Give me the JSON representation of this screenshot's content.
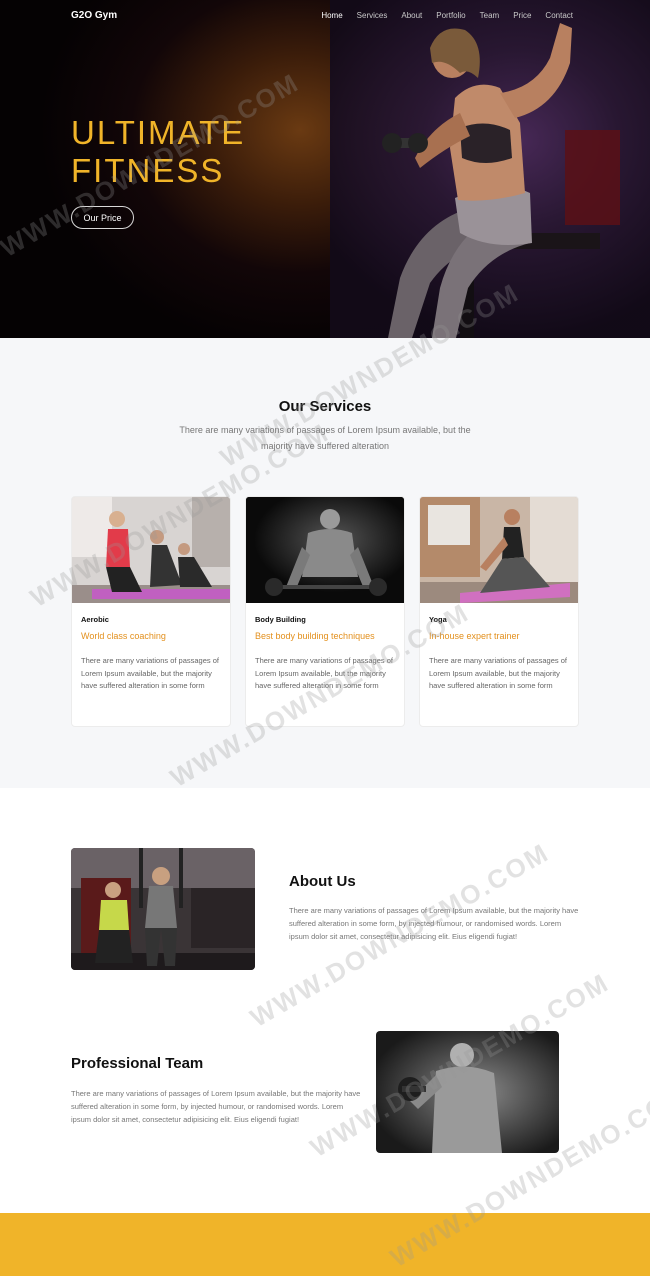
{
  "nav": {
    "brand": "G2O Gym",
    "items": [
      {
        "label": "Home"
      },
      {
        "label": "Services"
      },
      {
        "label": "About"
      },
      {
        "label": "Portfolio"
      },
      {
        "label": "Team"
      },
      {
        "label": "Price"
      },
      {
        "label": "Contact"
      }
    ]
  },
  "hero": {
    "title_line1": "ULTIMATE",
    "title_line2": "FITNESS",
    "button": "Our Price"
  },
  "services": {
    "title": "Our Services",
    "subtitle": "There are many variations of passages of Lorem Ipsum available, but the majority have suffered alteration",
    "cards": [
      {
        "category": "Aerobic",
        "heading": "World class coaching",
        "text": "There are many variations of passages of Lorem Ipsum available, but the majority have suffered alteration in some form"
      },
      {
        "category": "Body Building",
        "heading": "Best body building techniques",
        "text": "There are many variations of passages of Lorem Ipsum available, but the majority have suffered alteration in some form"
      },
      {
        "category": "Yoga",
        "heading": "In-house expert trainer",
        "text": "There are many variations of passages of Lorem Ipsum available, but the majority have suffered alteration in some form"
      }
    ]
  },
  "about": {
    "title": "About Us",
    "text": "There are many variations of passages of Lorem Ipsum available, but the majority have suffered alteration in some form, by injected humour, or randomised words. Lorem ipsum dolor sit amet, consectetur adipisicing elit. Eius eligendi fugiat!"
  },
  "team": {
    "title": "Professional Team",
    "text": "There are many variations of passages of Lorem Ipsum available, but the majority have suffered alteration in some form, by injected humour, or randomised words. Lorem ipsum dolor sit amet, consectetur adipisicing elit. Eius eligendi fugiat!"
  },
  "watermark": "WWW.DOWNDEMO.COM",
  "colors": {
    "accent": "#f0b429",
    "heading_orange": "#e3901d",
    "hero_bg": "#0a0406",
    "section_bg": "#f6f7f9"
  }
}
